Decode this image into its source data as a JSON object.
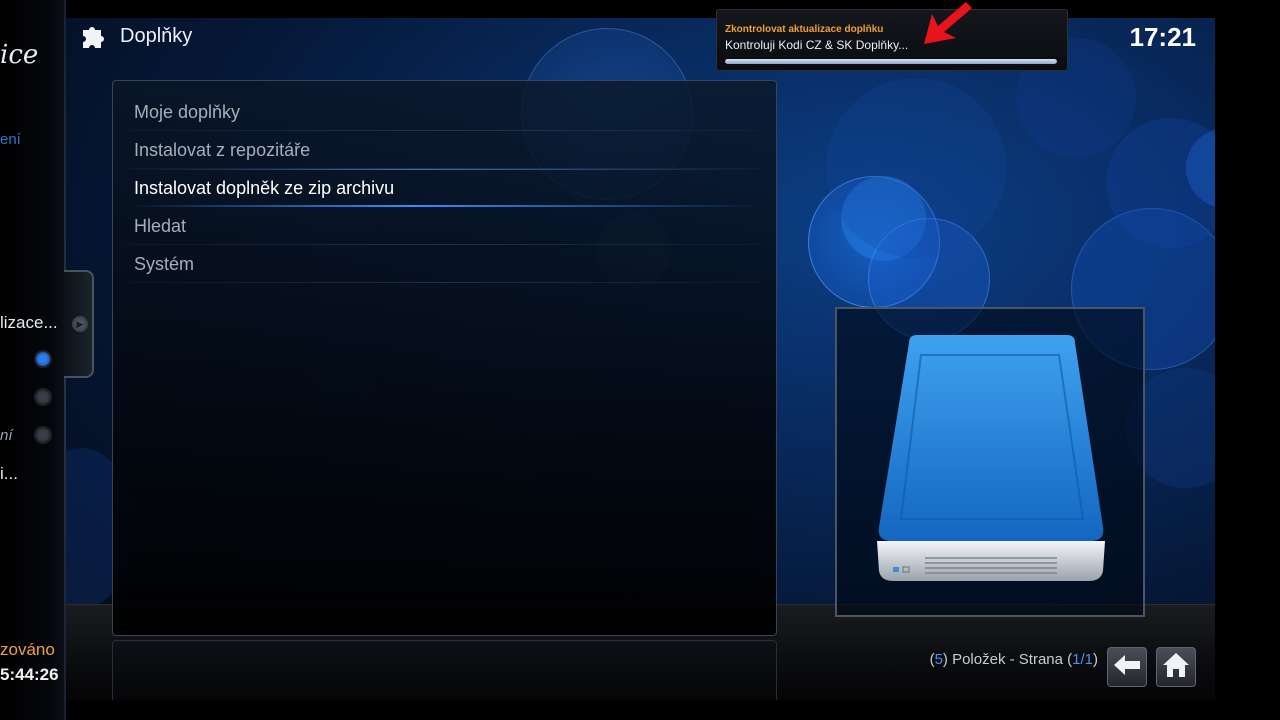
{
  "sidebar": {
    "logo_fragment": "ice",
    "blue_fragment": "ení",
    "item_fragment_1": "lizace...",
    "item_fragment_2": "ní",
    "item_fragment_3": "i...",
    "status_fragment": "zováno",
    "time_fragment": "5:44:26"
  },
  "header": {
    "title": "Doplňky",
    "icon": "puzzle-icon",
    "clock": "17:21"
  },
  "notification": {
    "title": "Zkontrolovat aktualizace doplňku",
    "message": "Kontroluji Kodi CZ & SK Doplňky...",
    "progress": 1.0
  },
  "menu": {
    "items": [
      {
        "label": "Moje doplňky"
      },
      {
        "label": "Instalovat z repozitáře"
      },
      {
        "label": "Instalovat doplněk ze zip archivu"
      },
      {
        "label": "Hledat"
      },
      {
        "label": "Systém"
      }
    ],
    "selected_index": 2
  },
  "thumbnail": {
    "icon": "hard-drive-icon"
  },
  "footer": {
    "count_open": "(",
    "count_value": "5",
    "count_middle": ") Položek - Strana (",
    "page_value": "1/1",
    "count_close": ")",
    "back_icon": "back-arrow-icon",
    "home_icon": "home-icon"
  },
  "colors": {
    "accent_blue": "#3a8dff",
    "notification_title": "#f0a030",
    "status_orange": "#f0a040",
    "arrow_red": "#e8141a"
  }
}
